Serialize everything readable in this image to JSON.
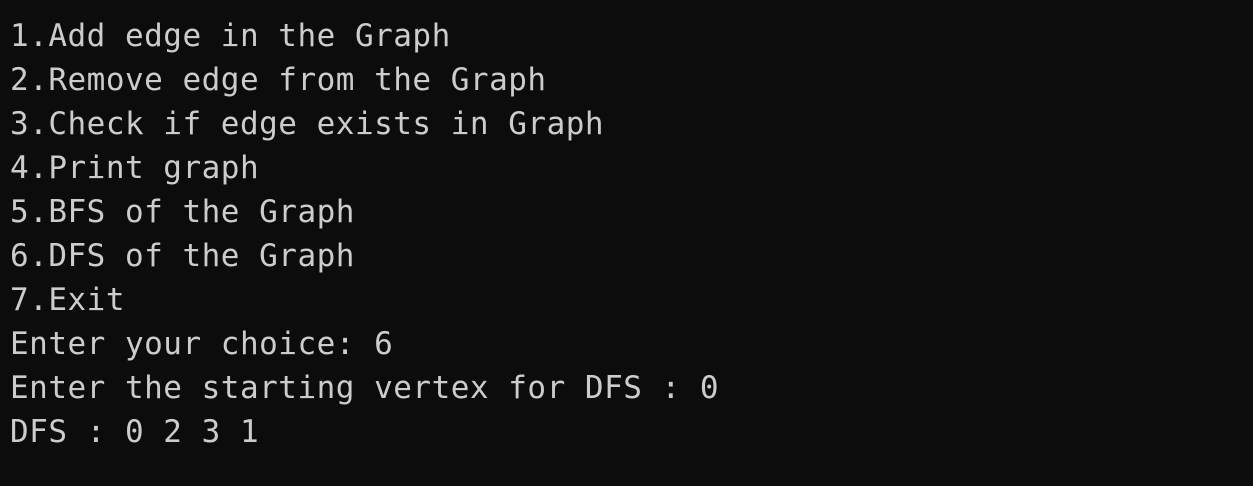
{
  "terminal": {
    "menu": [
      "1.Add edge in the Graph",
      "2.Remove edge from the Graph",
      "3.Check if edge exists in Graph",
      "4.Print graph",
      "5.BFS of the Graph",
      "6.DFS of the Graph",
      "7.Exit"
    ],
    "prompt_choice": "Enter your choice: 6",
    "prompt_vertex": "Enter the starting vertex for DFS : 0",
    "result": "DFS : 0 2 3 1"
  }
}
